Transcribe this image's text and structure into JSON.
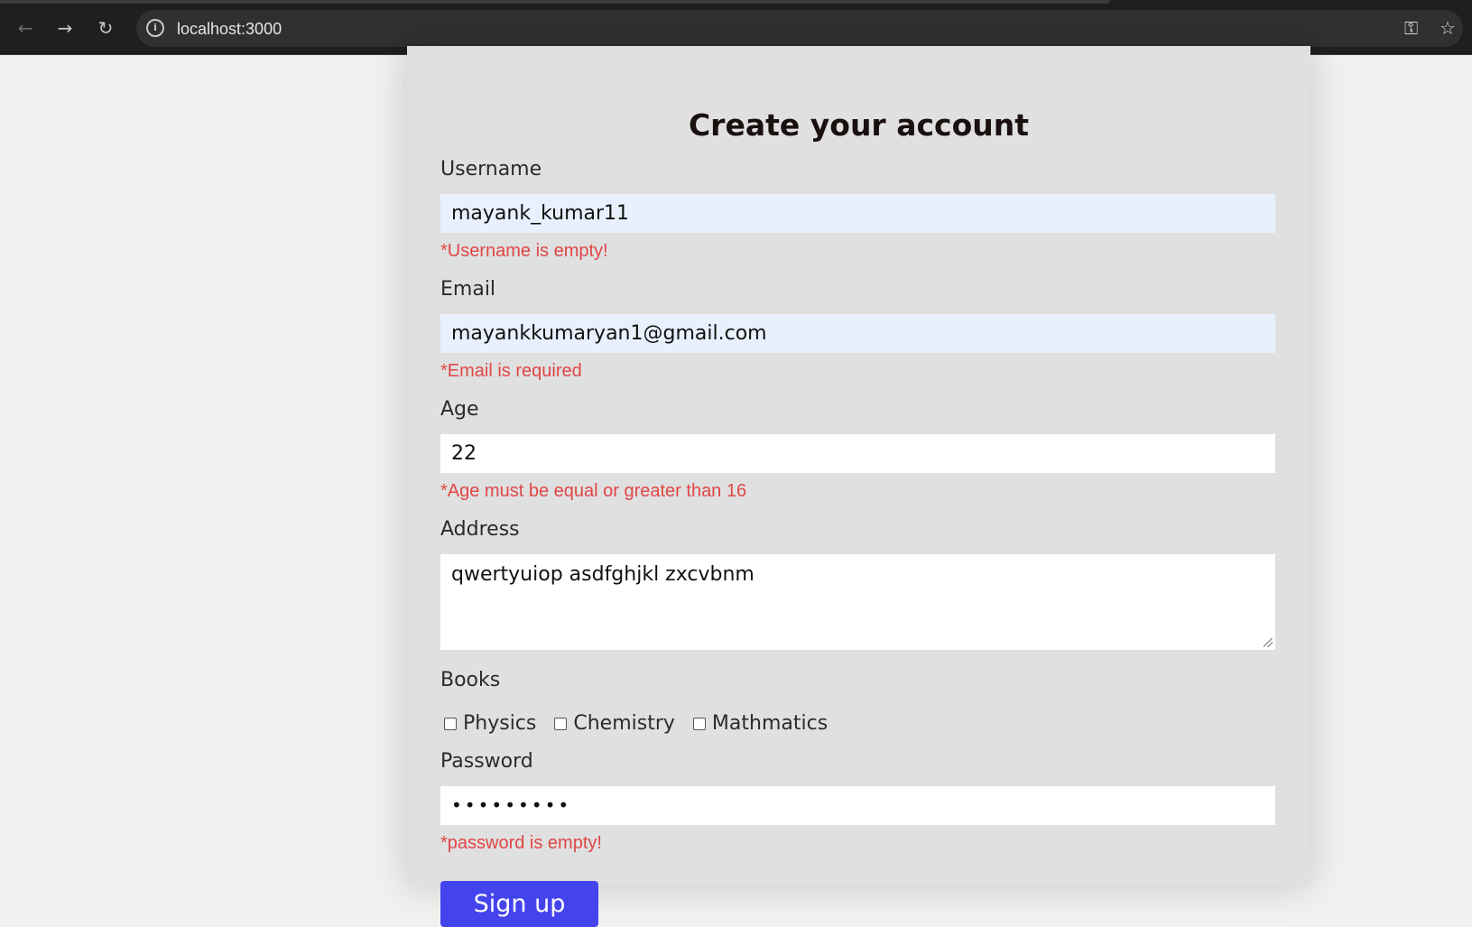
{
  "browser": {
    "url": "localhost:3000",
    "icons": {
      "back": "arrow-left-icon",
      "forward": "arrow-right-icon",
      "reload": "reload-icon",
      "site_info": "info-icon",
      "passwords": "key-icon",
      "bookmark": "star-icon"
    }
  },
  "form": {
    "title": "Create your account",
    "username": {
      "label": "Username",
      "value": "mayank_kumar11",
      "error": "*Username is empty!"
    },
    "email": {
      "label": "Email",
      "value": "mayankkumaryan1@gmail.com",
      "error": "*Email is required"
    },
    "age": {
      "label": "Age",
      "value": "22",
      "error": "*Age must be equal or greater than 16"
    },
    "address": {
      "label": "Address",
      "value": "qwertyuiop asdfghjkl zxcvbnm"
    },
    "books": {
      "label": "Books",
      "options": [
        "Physics",
        "Chemistry",
        "Mathmatics"
      ]
    },
    "password": {
      "label": "Password",
      "value": "•••••••••",
      "error": "*password is empty!"
    },
    "submit_label": "Sign up"
  },
  "colors": {
    "error": "#e04646",
    "button": "#4444ee",
    "autofill": "#e8f0fe",
    "card": "#e0e0e0"
  }
}
